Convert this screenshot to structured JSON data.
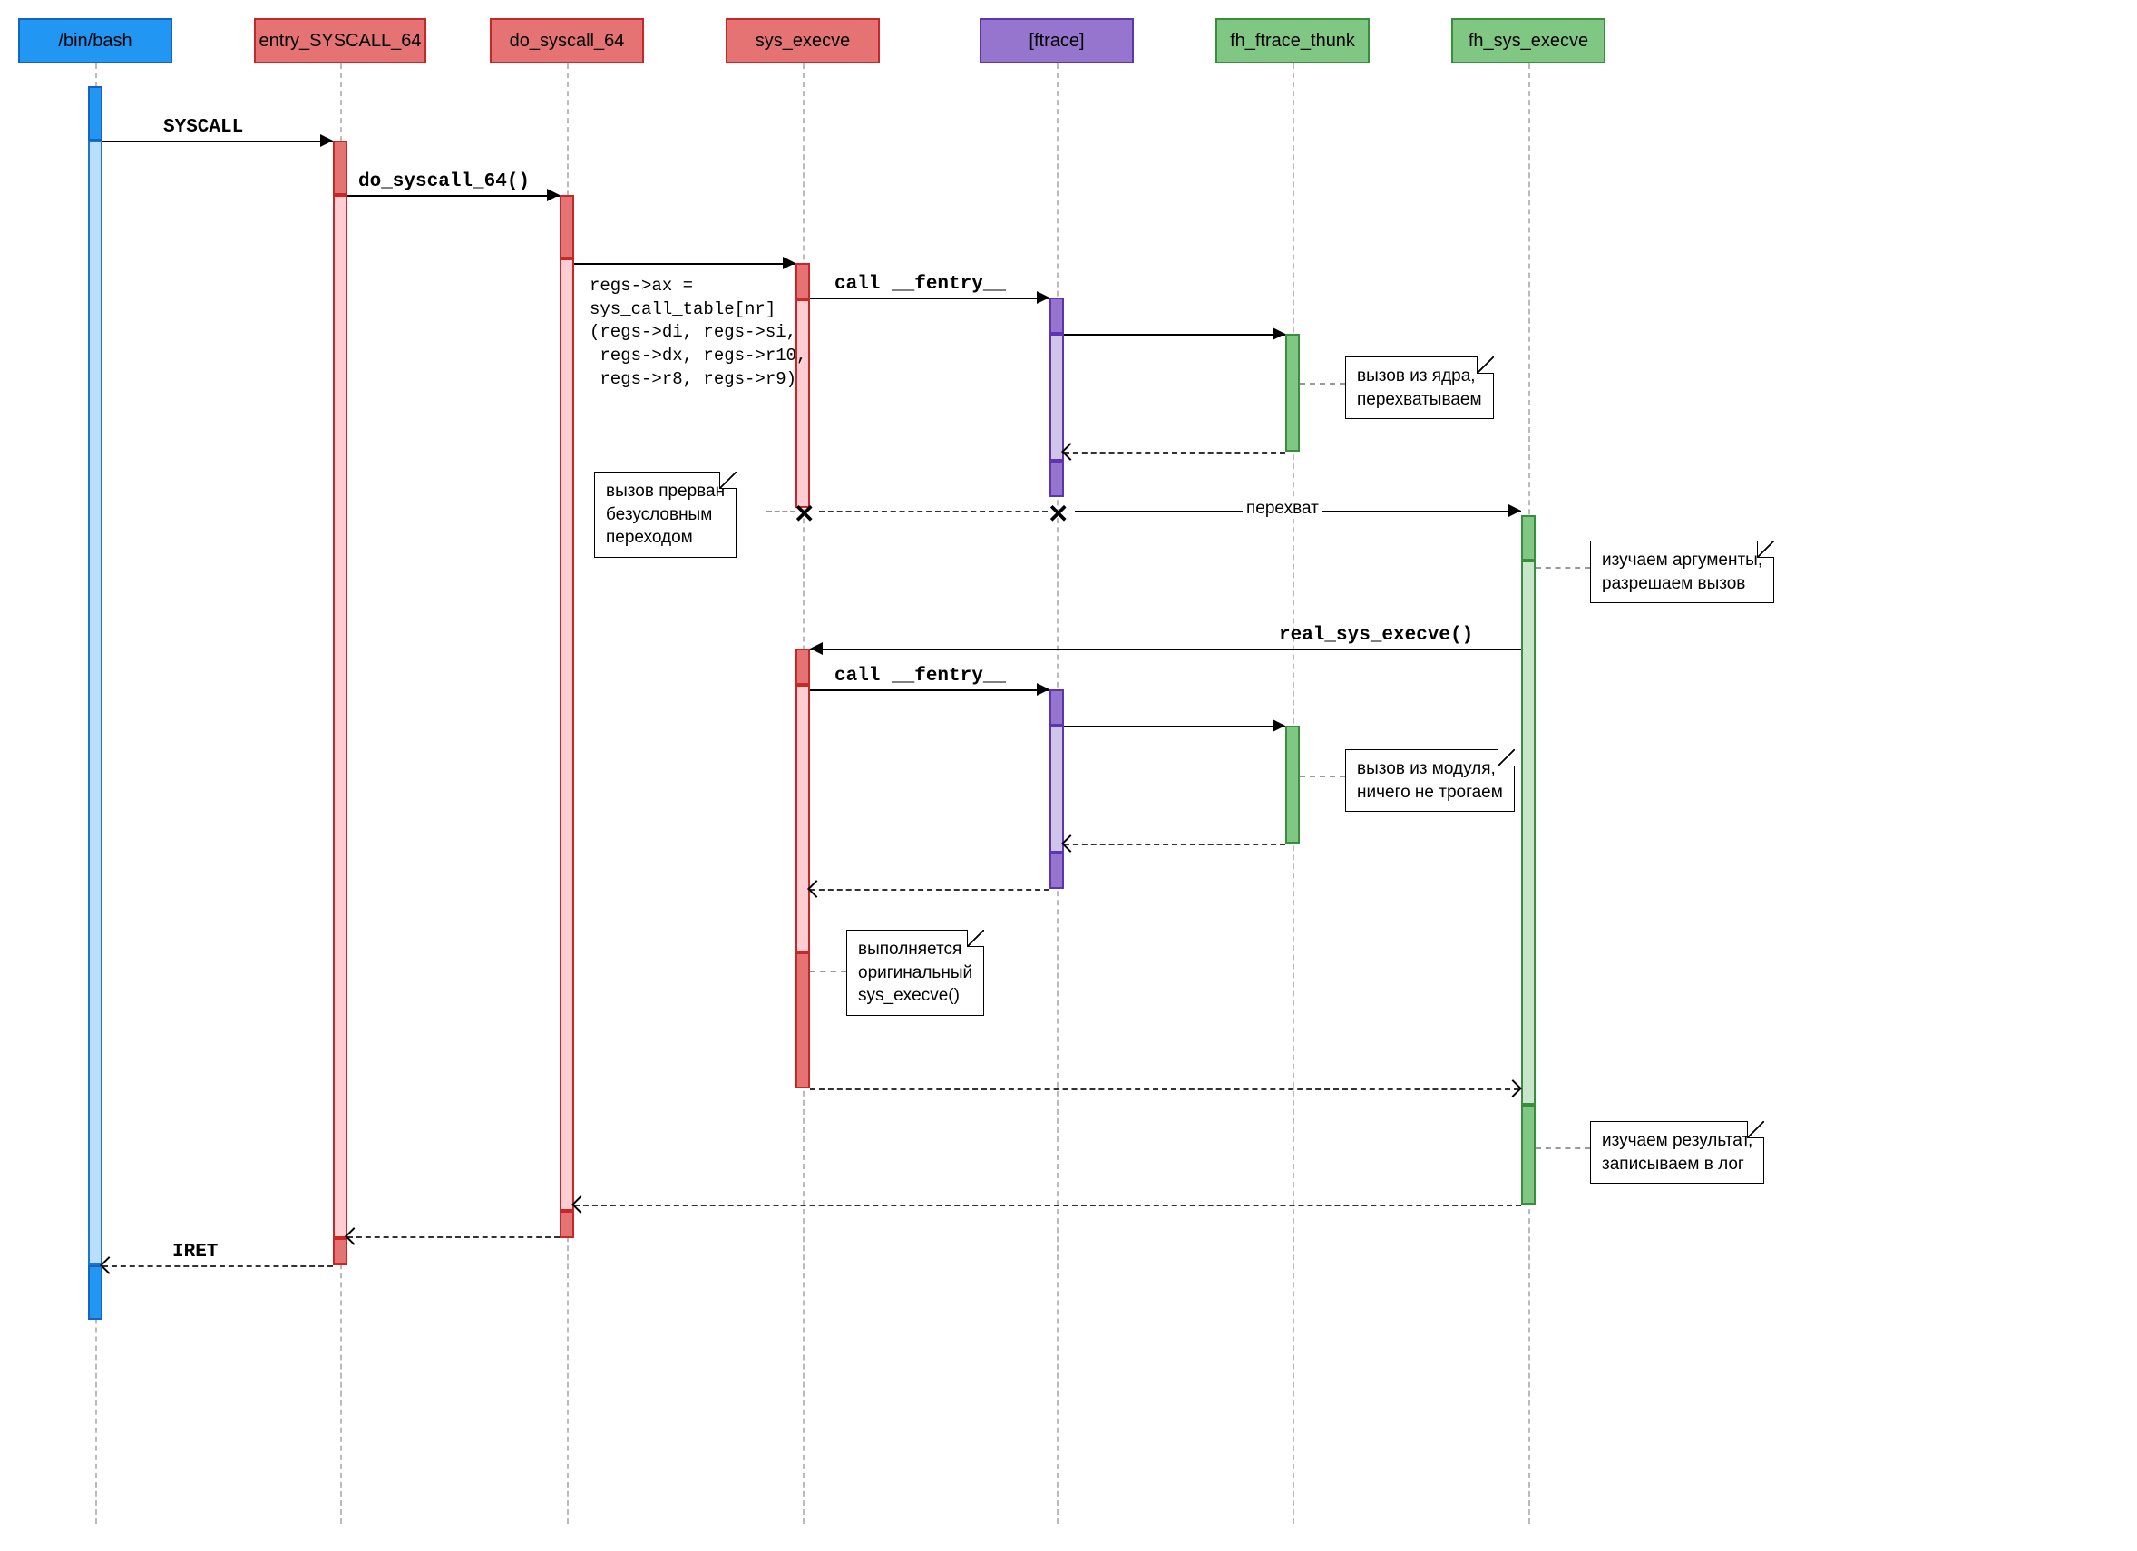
{
  "participants": [
    {
      "id": "bash",
      "label": "/bin/bash",
      "color": "blue"
    },
    {
      "id": "entry",
      "label": "entry_SYSCALL_64",
      "color": "red"
    },
    {
      "id": "do_syscall",
      "label": "do_syscall_64",
      "color": "red"
    },
    {
      "id": "sys_execve",
      "label": "sys_execve",
      "color": "red"
    },
    {
      "id": "ftrace",
      "label": "[ftrace]",
      "color": "purple"
    },
    {
      "id": "fh_thunk",
      "label": "fh_ftrace_thunk",
      "color": "green"
    },
    {
      "id": "fh_sys",
      "label": "fh_sys_execve",
      "color": "green"
    }
  ],
  "messages": {
    "syscall": "SYSCALL",
    "do_syscall": "do_syscall_64()",
    "regs": "regs->ax =\nsys_call_table[nr]\n(regs->di, regs->si,\n regs->dx, regs->r10,\n regs->r8, regs->r9)",
    "call_fentry1": "call __fentry__",
    "call_fentry2": "call __fentry__",
    "perehvat": "перехват",
    "real_sys": "real_sys_execve()",
    "iret": "IRET"
  },
  "notes": {
    "n1": "вызов из ядра,\nперехватываем",
    "n2": "вызов прерван\nбезусловным\nпереходом",
    "n3": "изучаем аргументы,\nразрешаем вызов",
    "n4": "вызов из модуля,\nничего не трогаем",
    "n5": "выполняется\nоригинальный\nsys_execve()",
    "n6": "изучаем результат,\nзаписываем в лог"
  }
}
